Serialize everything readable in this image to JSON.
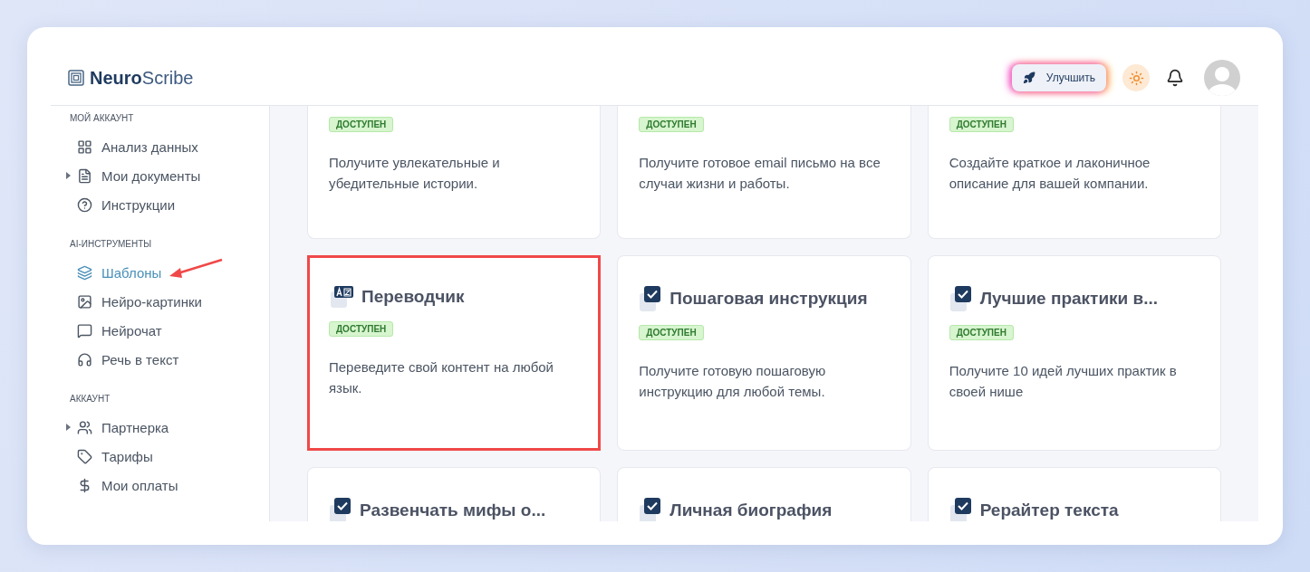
{
  "logo": {
    "bold": "Neuro",
    "light": "Scribe"
  },
  "header": {
    "upgrade": "Улучшить"
  },
  "sidebar": [
    {
      "heading": "МОЙ АККАУНТ",
      "items": [
        {
          "label": "Анализ данных",
          "selected": false
        },
        {
          "label": "Мои документы",
          "selected": false,
          "expanded": false
        },
        {
          "label": "Инструкции",
          "selected": false
        }
      ]
    },
    {
      "heading": "AI-ИНСТРУМЕНТЫ",
      "items": [
        {
          "label": "Шаблоны",
          "selected": true,
          "arrow": true
        },
        {
          "label": "Нейро-картинки",
          "selected": false
        },
        {
          "label": "Нейрочат",
          "selected": false
        },
        {
          "label": "Речь в текст",
          "selected": false
        }
      ]
    },
    {
      "heading": "АККАУНТ",
      "items": [
        {
          "label": "Партнерка",
          "selected": false,
          "expanded": false
        },
        {
          "label": "Тарифы",
          "selected": false
        },
        {
          "label": "Мои оплаты",
          "selected": false
        }
      ]
    }
  ],
  "cards": [
    {
      "badge": "ДОСТУПЕН",
      "description": "Получите увлекательные и убедительные истории.",
      "highlighted": false
    },
    {
      "badge": "ДОСТУПЕН",
      "description": "Получите готовое email письмо на все случаи жизни и работы.",
      "highlighted": false
    },
    {
      "badge": "ДОСТУПЕН",
      "description": "Создайте краткое и лаконичное описание для вашей компании.",
      "highlighted": false
    },
    {
      "kind": "translate",
      "title": "Переводчик",
      "badge": "ДОСТУПЕН",
      "description": "Переведите свой контент на любой язык.",
      "highlighted": true
    },
    {
      "kind": "check",
      "title": "Пошаговая инструкция",
      "badge": "ДОСТУПЕН",
      "description": "Получите готовую пошаговую инструкцию для любой темы.",
      "highlighted": false
    },
    {
      "kind": "check",
      "title": "Лучшие практики в...",
      "badge": "ДОСТУПЕН",
      "description": "Получите 10 идей лучших практик в своей нише",
      "highlighted": false
    },
    {
      "kind": "check",
      "title": "Развенчать мифы о...",
      "highlighted": false
    },
    {
      "kind": "check",
      "title": "Личная биография",
      "highlighted": false
    },
    {
      "kind": "check",
      "title": "Рерайтер текста",
      "highlighted": false
    }
  ]
}
